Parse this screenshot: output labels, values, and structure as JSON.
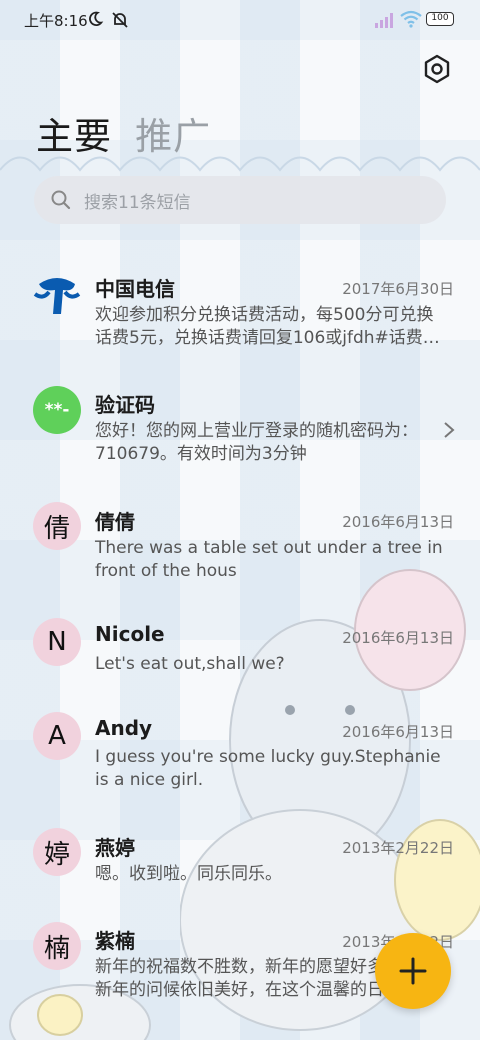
{
  "status": {
    "time": "上午8:16",
    "battery": "100"
  },
  "tabs": [
    {
      "label": "主要",
      "active": true
    },
    {
      "label": "推广",
      "active": false
    }
  ],
  "search": {
    "placeholder": "搜索11条短信"
  },
  "conversations": [
    {
      "name": "中国电信",
      "date": "2017年6月30日",
      "message": "欢迎参加积分兑换话费活动，每500分可兑换话费5元，兑换话费请回复106或jfdh#话费…",
      "avatar": "telecom-logo"
    },
    {
      "name": "验证码",
      "date": "",
      "message": "您好！您的网上营业厅登录的随机密码为：710679。有效时间为3分钟",
      "avatar_text": "**-"
    },
    {
      "name": "倩倩",
      "date": "2016年6月13日",
      "message": "There was a table set out under a tree in front of the hous",
      "avatar_text": "倩"
    },
    {
      "name": "Nicole",
      "date": "2016年6月13日",
      "message": "Let's eat out,shall we?",
      "avatar_text": "N"
    },
    {
      "name": "Andy",
      "date": "2016年6月13日",
      "message": "I guess you're some lucky guy.Stephanie is a nice girl.",
      "avatar_text": "A"
    },
    {
      "name": "燕婷",
      "date": "2013年2月22日",
      "message": "嗯。收到啦。同乐同乐。",
      "avatar_text": "婷"
    },
    {
      "name": "紫楠",
      "date": "2013年2月22日",
      "message": "新年的祝福数不胜数，新年的愿望好多好多，新年的问候依旧美好，在这个温馨的日子",
      "avatar_text": "楠"
    }
  ],
  "colors": {
    "fab": "#f7b512",
    "verify_avatar": "#5fd05a",
    "contact_avatar": "#f1d2dd",
    "telecom_blue": "#0a5bb0"
  },
  "icons": {
    "settings": "settings-icon",
    "search": "search-icon",
    "compose": "plus-icon",
    "chevron": "chevron-right-icon"
  }
}
